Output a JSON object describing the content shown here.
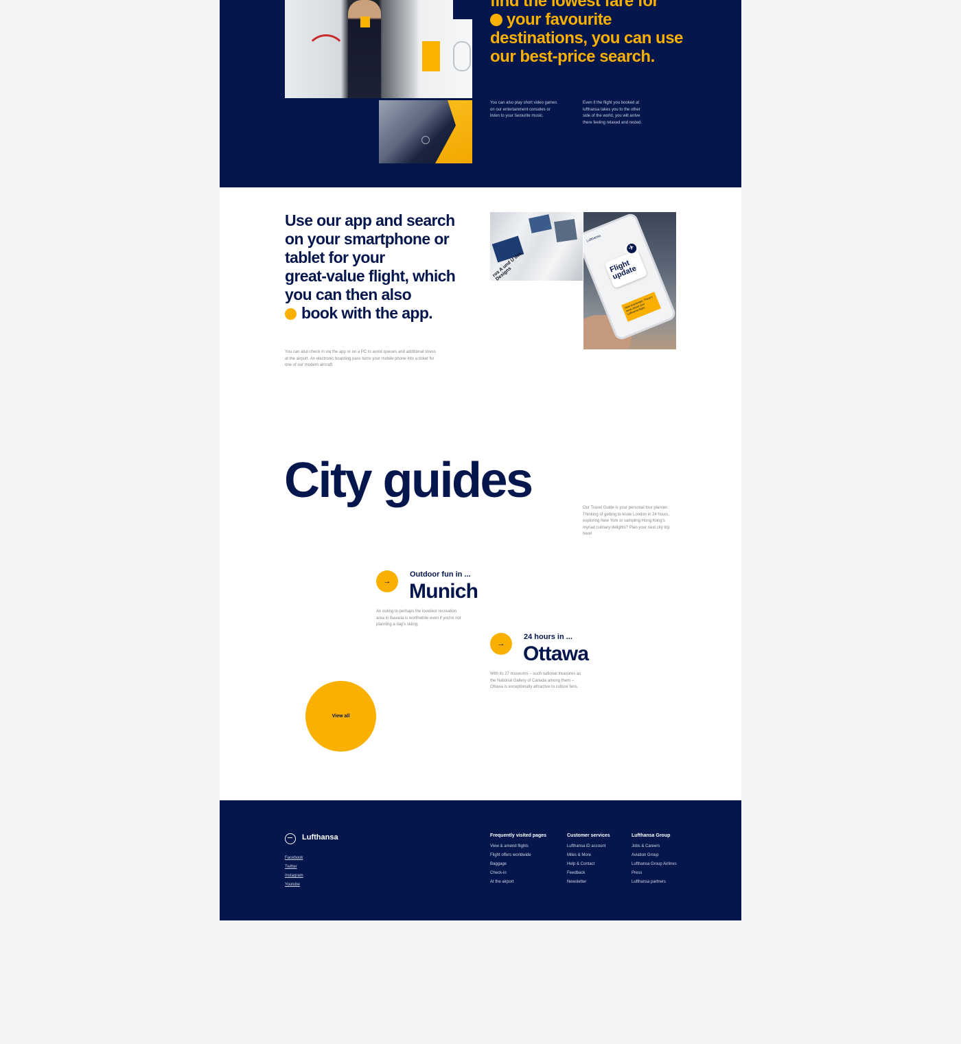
{
  "hero": {
    "heading_line0": "find the lowest fare for",
    "heading_line1": "your favourite",
    "heading_line2": "destinations, you can use",
    "heading_line3": "our best-price search.",
    "copy_left": "You can also play short video games on our entertainment consoles or listen to your favourite music.",
    "copy_right": "Even if the flight you booked at lufthansa takes you to the other side of the world, you will arrive there feeling relaxed and rested."
  },
  "app": {
    "heading_lines": [
      "Use our app and search",
      "on your smartphone or",
      "tablet for your",
      "great-value flight, which",
      "you can then also"
    ],
    "heading_last": "book with the app.",
    "copy": "You can also check in via the app or on a PC to avoid queues and additional stress at the airport. An electronic boarding pass turns your mobile phone into a ticket for one of our modern aircraft.",
    "magazine_text": "ros A und U des Designs",
    "phone_brand": "Lufthansa",
    "phone_bubble": "Flight update",
    "phone_note": "Dear passenger, There's news about your Lufthansa flight."
  },
  "city_guides": {
    "title": "City guides",
    "copy": "Our Travel Guide is your personal tour planner. Thinking of getting to know London in 24 hours, exploring New York or sampling Hong Kong's myriad culinary delights? Plan your next city trip here!",
    "guides": [
      {
        "kicker": "Outdoor fun in ...",
        "city": "Munich",
        "blurb": "An outing to perhaps the loveliest recreation area in Bavaria is worthwhile even if you're not planning a day's skiing."
      },
      {
        "kicker": "24 hours in ...",
        "city": "Ottawa",
        "blurb": "With its 27 museums – such national treasures as the National Gallery of Canada among them – Ottawa is exceptionally attractive to culture fans."
      }
    ],
    "arrow_glyph": "→",
    "view_all": "View all"
  },
  "footer": {
    "brand": "Lufthansa",
    "social": [
      "Facebook",
      "Twitter",
      "Instagram",
      "Youtube"
    ],
    "columns": [
      {
        "title": "Frequently visited pages",
        "links": [
          "View & amend flights",
          "Flight offers worldwide",
          "Baggage",
          "Check-in",
          "At the airport"
        ]
      },
      {
        "title": "Customer services",
        "links": [
          "Lufthansa iD account",
          "Miles & More",
          "Help & Contact",
          "Feedback",
          "Newsletter"
        ]
      },
      {
        "title": "Lufthansa Group",
        "links": [
          "Jobs & Careers",
          "Aviation Group",
          "Lufthansa Group Airlines",
          "Press",
          "Lufthansa partners"
        ]
      }
    ]
  },
  "colors": {
    "navy": "#05164d",
    "yellow": "#f9b000",
    "page_bg": "#f4f4f4"
  },
  "icons": [
    "arrow-right-icon",
    "lufthansa-crane-logo",
    "plane-icon"
  ]
}
